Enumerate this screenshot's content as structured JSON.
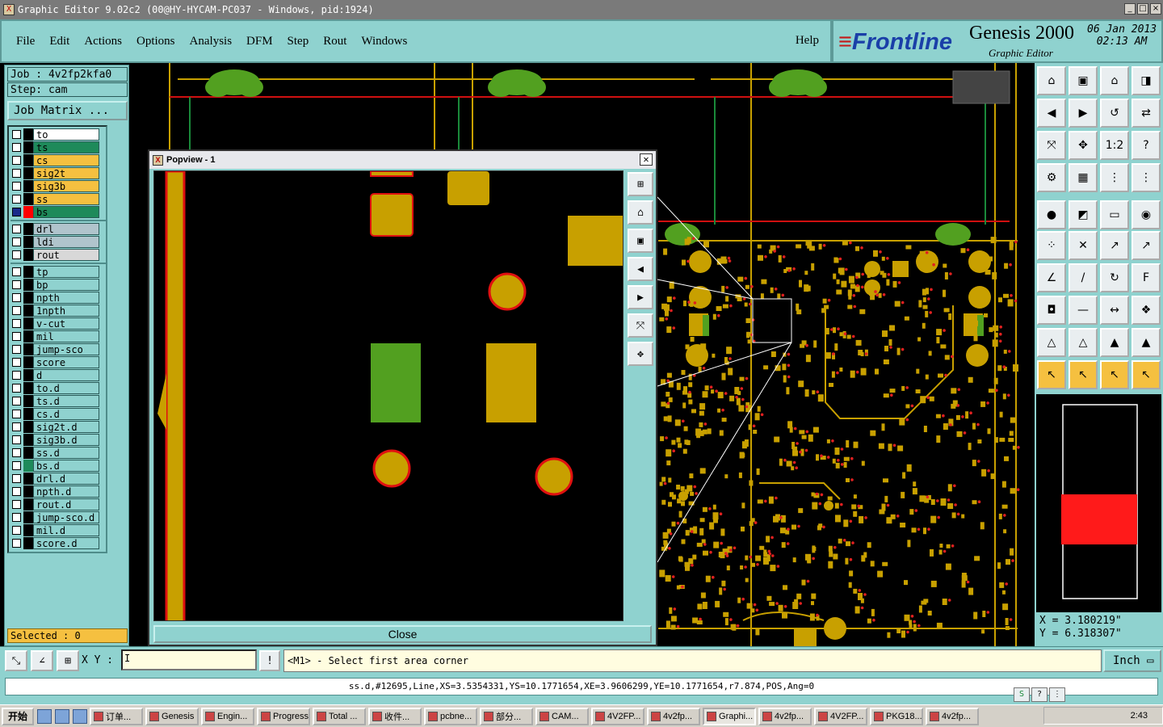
{
  "window": {
    "title": "Graphic Editor 9.02c2 (00@HY-HYCAM-PC037 - Windows, pid:1924)"
  },
  "menu": {
    "items": [
      "File",
      "Edit",
      "Actions",
      "Options",
      "Analysis",
      "DFM",
      "Step",
      "Rout",
      "Windows"
    ],
    "help": "Help"
  },
  "brand": {
    "logo": "Frontline",
    "product": "Genesis 2000",
    "subtitle": "Graphic Editor",
    "date": "06 Jan 2013",
    "time": "02:13 AM"
  },
  "job": {
    "job_line": "Job : 4v2fp2kfa0",
    "step_line": "Step: cam",
    "matrix_button": "Job Matrix ..."
  },
  "layers": {
    "group1": [
      {
        "name": "to",
        "color": "#ffffff",
        "swatch": "#000000"
      },
      {
        "name": "ts",
        "color": "#1e8a5a",
        "swatch": "#000000"
      },
      {
        "name": "cs",
        "color": "#f5c040",
        "swatch": "#000000"
      },
      {
        "name": "sig2t",
        "color": "#f5c040",
        "swatch": "#000000"
      },
      {
        "name": "sig3b",
        "color": "#f5c040",
        "swatch": "#000000"
      },
      {
        "name": "ss",
        "color": "#f5c040",
        "swatch": "#000000"
      },
      {
        "name": "bs",
        "color": "#1e8a5a",
        "swatch": "#ff0000",
        "active": true
      }
    ],
    "group2": [
      {
        "name": "drl",
        "color": "#b0c4cc",
        "swatch": "#000000"
      },
      {
        "name": "ldi",
        "color": "#b0c4cc",
        "swatch": "#000000"
      },
      {
        "name": "rout",
        "color": "#d8d8d8",
        "swatch": "#000000"
      }
    ],
    "group3": [
      {
        "name": "tp",
        "color": "#8fd2cf",
        "swatch": "#000000"
      },
      {
        "name": "bp",
        "color": "#8fd2cf",
        "swatch": "#000000"
      },
      {
        "name": "npth",
        "color": "#8fd2cf",
        "swatch": "#000000"
      },
      {
        "name": "1npth",
        "color": "#8fd2cf",
        "swatch": "#000000"
      },
      {
        "name": "v-cut",
        "color": "#8fd2cf",
        "swatch": "#000000"
      },
      {
        "name": "mil",
        "color": "#8fd2cf",
        "swatch": "#000000"
      },
      {
        "name": "jump-sco",
        "color": "#8fd2cf",
        "swatch": "#000000"
      },
      {
        "name": "score",
        "color": "#8fd2cf",
        "swatch": "#000000"
      },
      {
        "name": "d",
        "color": "#8fd2cf",
        "swatch": "#000000"
      },
      {
        "name": "to.d",
        "color": "#8fd2cf",
        "swatch": "#000000"
      },
      {
        "name": "ts.d",
        "color": "#8fd2cf",
        "swatch": "#000000"
      },
      {
        "name": "cs.d",
        "color": "#8fd2cf",
        "swatch": "#000000"
      },
      {
        "name": "sig2t.d",
        "color": "#8fd2cf",
        "swatch": "#000000"
      },
      {
        "name": "sig3b.d",
        "color": "#8fd2cf",
        "swatch": "#000000"
      },
      {
        "name": "ss.d",
        "color": "#8fd2cf",
        "swatch": "#000000"
      },
      {
        "name": "bs.d",
        "color": "#8fd2cf",
        "swatch": "#1e8a5a"
      },
      {
        "name": "drl.d",
        "color": "#8fd2cf",
        "swatch": "#000000"
      },
      {
        "name": "npth.d",
        "color": "#8fd2cf",
        "swatch": "#000000"
      },
      {
        "name": "rout.d",
        "color": "#8fd2cf",
        "swatch": "#000000"
      },
      {
        "name": "jump-sco.d",
        "color": "#8fd2cf",
        "swatch": "#000000"
      },
      {
        "name": "mil.d",
        "color": "#8fd2cf",
        "swatch": "#000000"
      },
      {
        "name": "score.d",
        "color": "#8fd2cf",
        "swatch": "#000000"
      }
    ]
  },
  "selected": "Selected : 0",
  "popview": {
    "title": "Popview - 1",
    "close_button": "Close"
  },
  "coords": {
    "x": "X = 3.180219\"",
    "y": "Y = 6.318307\""
  },
  "command": {
    "xy_label": "X Y :",
    "prompt": "<M1> - Select first area corner",
    "unit": "Inch"
  },
  "status": "ss.d,#12695,Line,XS=3.5354331,YS=10.1771654,XE=3.9606299,YE=10.1771654,r7.874,POS,Ang=0",
  "taskbar": {
    "start": "开始",
    "tasks": [
      "订单...",
      "Genesis",
      "Engin...",
      "Progress",
      "Total ...",
      "收件...",
      "pcbne...",
      "部分...",
      "CAM...",
      "4V2FP...",
      "4v2fp...",
      "Graphi...",
      "4v2fp...",
      "4V2FP...",
      "PKG18...",
      "4v2fp..."
    ],
    "active_index": 11,
    "clock": "2:43"
  },
  "colors": {
    "panel": "#8fd2cf",
    "copper": "#c8a000",
    "green_pad": "#52a020",
    "red_outline": "#ff1a1a",
    "selected_yellow": "#f5c040"
  }
}
